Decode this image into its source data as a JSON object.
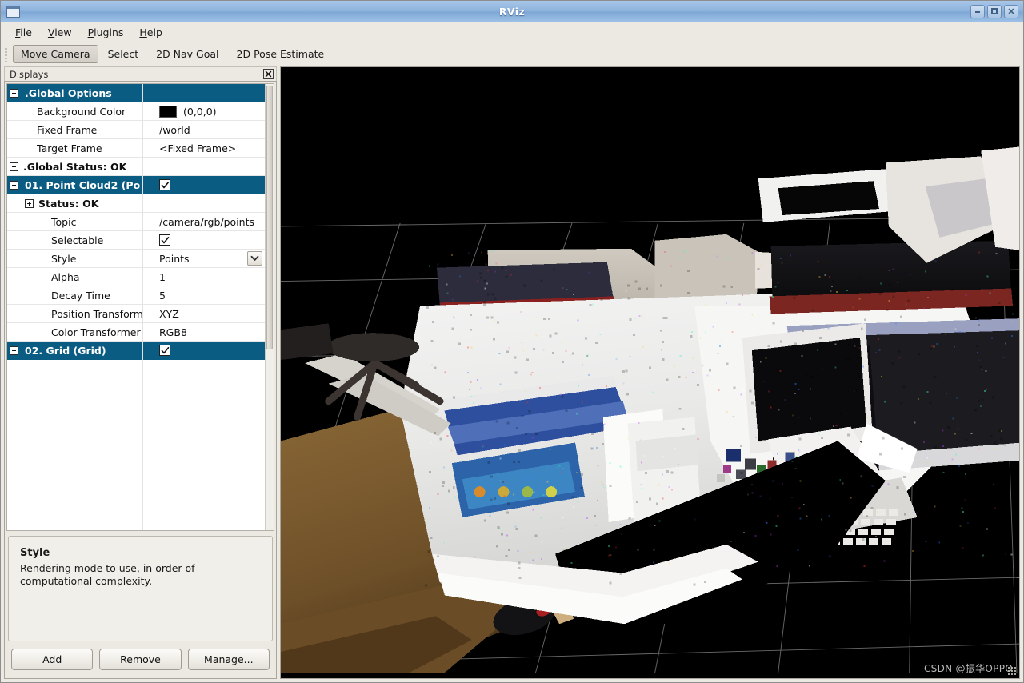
{
  "window": {
    "title": "RViz",
    "icon": "window-icon",
    "buttons": [
      {
        "name": "minimize",
        "glyph": "minimize-icon"
      },
      {
        "name": "maximize",
        "glyph": "maximize-icon"
      },
      {
        "name": "close",
        "glyph": "close-icon"
      }
    ]
  },
  "menubar": {
    "items": [
      {
        "label": "File",
        "mnemonic": "F"
      },
      {
        "label": "View",
        "mnemonic": "V"
      },
      {
        "label": "Plugins",
        "mnemonic": "P"
      },
      {
        "label": "Help",
        "mnemonic": "H"
      }
    ]
  },
  "toolbar": {
    "items": [
      {
        "label": "Move Camera",
        "active": true
      },
      {
        "label": "Select",
        "active": false
      },
      {
        "label": "2D Nav Goal",
        "active": false
      },
      {
        "label": "2D Pose Estimate",
        "active": false
      }
    ]
  },
  "displays_panel": {
    "title": "Displays",
    "close_glyph": "☒",
    "highlight_color": "#0b5c82",
    "tree": [
      {
        "id": "global-options",
        "label": ".Global Options",
        "indent": 0,
        "expander": "minus",
        "selected": true,
        "header": true,
        "value": ""
      },
      {
        "id": "background-color",
        "label": "Background Color",
        "indent": 1,
        "expander": "none",
        "value": "(0,0,0)",
        "swatch": "#000000"
      },
      {
        "id": "fixed-frame",
        "label": "Fixed Frame",
        "indent": 1,
        "expander": "none",
        "value": "/world"
      },
      {
        "id": "target-frame",
        "label": "Target Frame",
        "indent": 1,
        "expander": "none",
        "value": "<Fixed Frame>"
      },
      {
        "id": "global-status",
        "label": ".Global Status: OK",
        "indent": 0,
        "expander": "plus",
        "header": true,
        "value": ""
      },
      {
        "id": "point-cloud2",
        "label": "01. Point Cloud2 (Po",
        "indent": 0,
        "expander": "minus",
        "selected": true,
        "header": true,
        "checkbox": true,
        "value": ""
      },
      {
        "id": "pc-status",
        "label": "Status: OK",
        "indent": 1,
        "expander": "plus",
        "header": true,
        "value": ""
      },
      {
        "id": "pc-topic",
        "label": "Topic",
        "indent": 2,
        "expander": "none",
        "value": "/camera/rgb/points"
      },
      {
        "id": "pc-selectable",
        "label": "Selectable",
        "indent": 2,
        "expander": "none",
        "checkbox": true,
        "value": ""
      },
      {
        "id": "pc-style",
        "label": "Style",
        "indent": 2,
        "expander": "none",
        "value": "Points",
        "combo": true
      },
      {
        "id": "pc-alpha",
        "label": "Alpha",
        "indent": 2,
        "expander": "none",
        "value": "1"
      },
      {
        "id": "pc-decay-time",
        "label": "Decay Time",
        "indent": 2,
        "expander": "none",
        "value": "5"
      },
      {
        "id": "pc-position-transform",
        "label": "Position Transform",
        "indent": 2,
        "expander": "none",
        "value": "XYZ"
      },
      {
        "id": "pc-color-transformer",
        "label": "Color Transformer",
        "indent": 2,
        "expander": "none",
        "value": "RGB8"
      },
      {
        "id": "grid",
        "label": "02. Grid (Grid)",
        "indent": 0,
        "expander": "plus",
        "selected": true,
        "header": true,
        "checkbox": true,
        "value": ""
      }
    ],
    "help": {
      "title": "Style",
      "text": "Rendering mode to use, in order of computational complexity."
    },
    "buttons": [
      {
        "label": "Add"
      },
      {
        "label": "Remove"
      },
      {
        "label": "Manage..."
      }
    ]
  },
  "view3d": {
    "background_color": "#000000",
    "grid_color": "#8f8f8f",
    "watermark": "CSDN @振华OPPO",
    "scene_description": "RGB point cloud of an office desk with two monitors, keyboard, papers and an office chair on a wooden floor"
  }
}
